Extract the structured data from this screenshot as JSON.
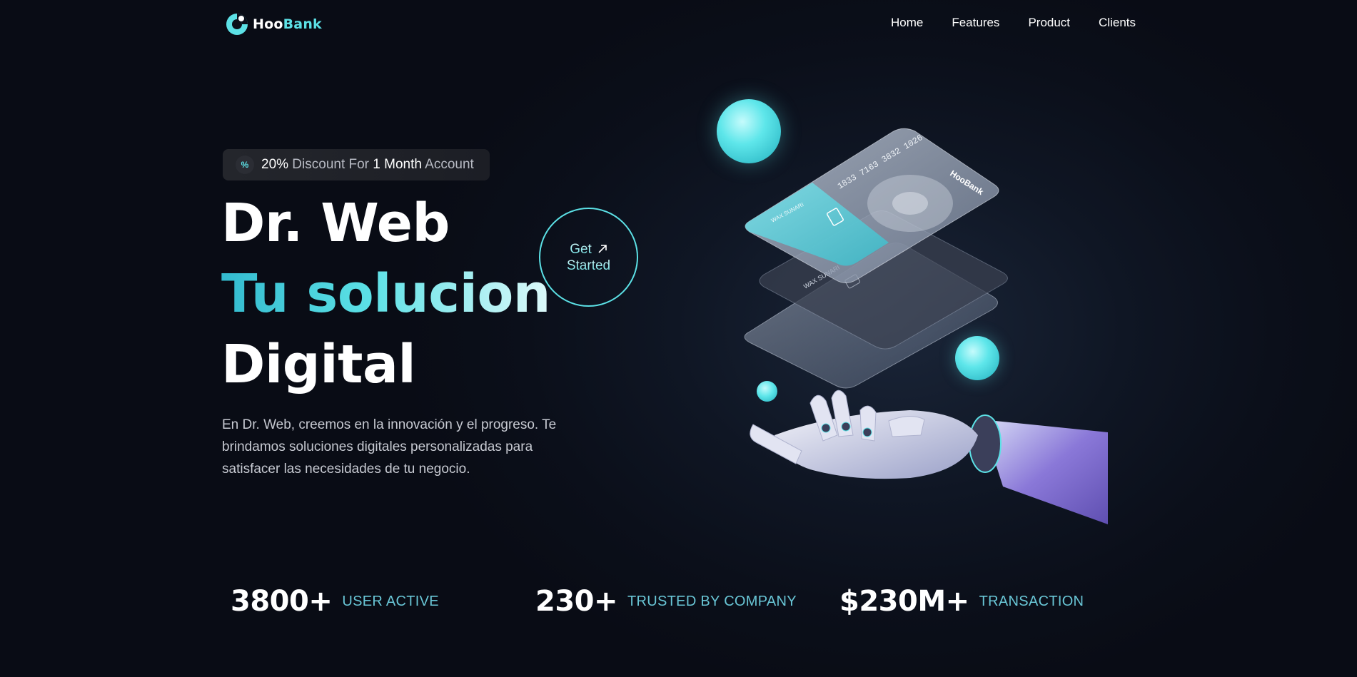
{
  "brand": {
    "name_part1": "Hoo",
    "name_part2": "Bank"
  },
  "nav": {
    "items": [
      "Home",
      "Features",
      "Product",
      "Clients"
    ]
  },
  "badge": {
    "icon": "percent-icon",
    "pct": "20%",
    "text1": " Discount For ",
    "months": "1 Month",
    "text2": " Account"
  },
  "hero": {
    "line1": "Dr. Web",
    "line2": "Tu solucion",
    "line3": "Digital",
    "description": "En Dr. Web, creemos en la innovación y el progreso. Te brindamos soluciones digitales personalizadas para satisfacer las necesidades de tu negocio."
  },
  "cta": {
    "line1": "Get",
    "line2": "Started",
    "icon": "arrow-up-right-icon"
  },
  "cards": {
    "number": "1833 7163 3832 1026",
    "holder": "WAX SUNARI",
    "brand": "HooBank"
  },
  "stats": [
    {
      "value": "3800+",
      "label": "USER ACTIVE"
    },
    {
      "value": "230+",
      "label": "TRUSTED BY COMPANY"
    },
    {
      "value": "$230M+",
      "label": "TRANSACTION"
    }
  ],
  "colors": {
    "accent": "#5ce1e6",
    "background": "#0b0f1a",
    "stat_label": "#69c6d6"
  }
}
